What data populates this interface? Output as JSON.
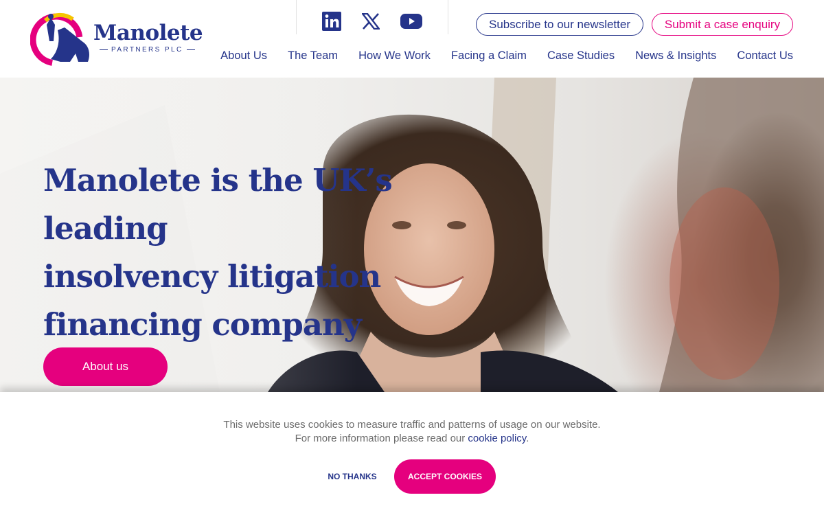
{
  "brand": {
    "name": "Manolete",
    "subtitle": "PARTNERS PLC",
    "primary_color": "#25348a",
    "accent_color": "#e5007e"
  },
  "social": [
    {
      "icon": "linkedin-icon"
    },
    {
      "icon": "x-icon"
    },
    {
      "icon": "youtube-icon"
    }
  ],
  "header_buttons": {
    "newsletter": "Subscribe to our newsletter",
    "enquiry": "Submit a case enquiry"
  },
  "nav": {
    "items": [
      {
        "label": "About Us"
      },
      {
        "label": "The Team"
      },
      {
        "label": "How We Work"
      },
      {
        "label": "Facing a Claim"
      },
      {
        "label": "Case Studies"
      },
      {
        "label": "News & Insights"
      },
      {
        "label": "Contact Us"
      }
    ]
  },
  "hero": {
    "line1": "Manolete is the UK’s leading",
    "line2": "insolvency litigation",
    "line3": "financing company",
    "cta": "About us"
  },
  "cookie": {
    "text_line1": "This website uses cookies to measure traffic and patterns of usage on our website.",
    "text_line2_prefix": "For more information please read our ",
    "link": "cookie policy",
    "text_line2_suffix": ".",
    "decline": "NO THANKS",
    "accept": "ACCEPT COOKIES"
  }
}
